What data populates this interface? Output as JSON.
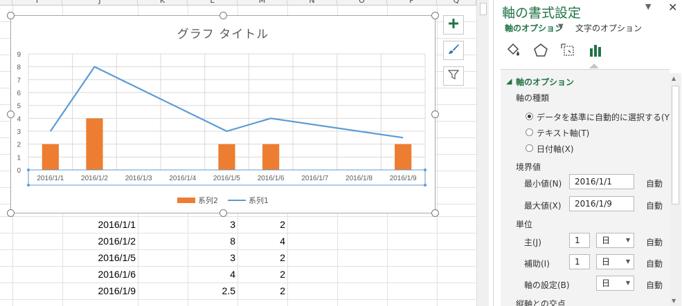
{
  "sheet": {
    "column_headers": [
      "I",
      "J",
      "K",
      "L",
      "M",
      "N",
      "O",
      "P",
      "Q"
    ],
    "rows": [
      {
        "date": "2016/1/1",
        "v1": "3",
        "v2": "2"
      },
      {
        "date": "2016/1/2",
        "v1": "8",
        "v2": "4"
      },
      {
        "date": "2016/1/5",
        "v1": "3",
        "v2": "2"
      },
      {
        "date": "2016/1/6",
        "v1": "4",
        "v2": "2"
      },
      {
        "date": "2016/1/9",
        "v1": "2.5",
        "v2": "2"
      }
    ]
  },
  "chart": {
    "title": "グラフ タイトル",
    "legend": [
      "系列2",
      "系列1"
    ],
    "bar_color": "#ed7d31",
    "line_color": "#5b9bd5"
  },
  "chart_data": {
    "type": "bar",
    "title": "グラフ タイトル",
    "categories": [
      "2016/1/1",
      "2016/1/2",
      "2016/1/3",
      "2016/1/4",
      "2016/1/5",
      "2016/1/6",
      "2016/1/7",
      "2016/1/8",
      "2016/1/9"
    ],
    "y_ticks": [
      "0",
      "1",
      "2",
      "3",
      "4",
      "5",
      "6",
      "7",
      "8",
      "9"
    ],
    "ylim": [
      0,
      9
    ],
    "grid": true,
    "legend_position": "bottom",
    "series": [
      {
        "name": "系列2",
        "type": "bar",
        "x": [
          "2016/1/1",
          "2016/1/2",
          "2016/1/5",
          "2016/1/6",
          "2016/1/9"
        ],
        "values": [
          2,
          4,
          2,
          2,
          2
        ]
      },
      {
        "name": "系列1",
        "type": "line",
        "x": [
          "2016/1/1",
          "2016/1/2",
          "2016/1/5",
          "2016/1/6",
          "2016/1/9"
        ],
        "values": [
          3,
          8,
          3,
          4,
          2.5
        ]
      }
    ]
  },
  "chart_buttons": {
    "elements": "plus-icon",
    "styles": "brush-icon",
    "filters": "filter-icon"
  },
  "pane": {
    "title": "軸の書式設定",
    "dropdown_glyph": "▼",
    "close_glyph": "✕",
    "tab_axis": "軸のオプション",
    "tab_axis_arrow": "▼",
    "tab_text": "文字のオプション",
    "section_title": "軸のオプション",
    "section_arrow": "◢",
    "axis_type_label": "軸の種類",
    "radio_auto": "データを基準に自動的に選択する(Y)",
    "radio_text": "テキスト軸(T)",
    "radio_date": "日付軸(X)",
    "bounds_label": "境界値",
    "min_label": "最小値(N)",
    "min_value": "2016/1/1",
    "max_label": "最大値(X)",
    "max_value": "2016/1/9",
    "auto_label": "自動",
    "units_label": "単位",
    "major_label": "主(J)",
    "major_value": "1",
    "major_unit": "日",
    "minor_label": "補助(I)",
    "minor_value": "1",
    "minor_unit": "日",
    "base_label": "軸の設定(B)",
    "base_unit": "日",
    "cross_label": "縦軸との交点"
  }
}
